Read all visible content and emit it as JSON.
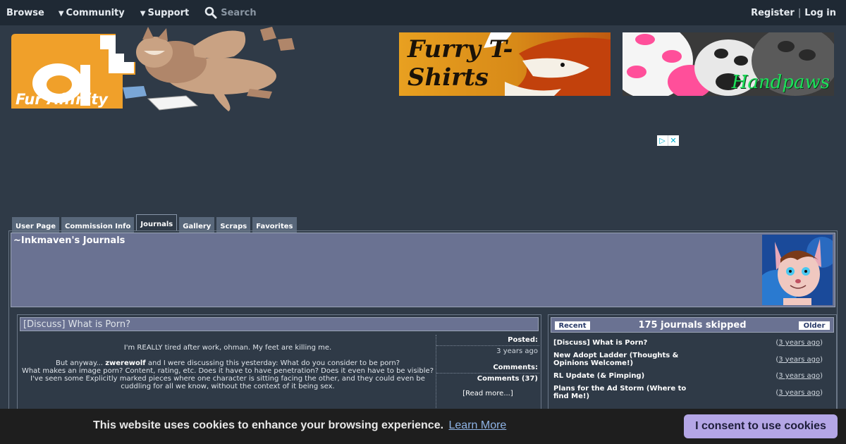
{
  "nav": {
    "browse": "Browse",
    "community": "Community",
    "support": "Support",
    "search_placeholder": "Search",
    "register": "Register",
    "sep": "|",
    "login": "Log in"
  },
  "logo": {
    "text": "Fur Affinity"
  },
  "banners": {
    "shirts": "Furry T-Shirts",
    "paws": "Handpaws"
  },
  "tabs": [
    {
      "label": "User Page"
    },
    {
      "label": "Commission Info"
    },
    {
      "label": "Journals",
      "active": true
    },
    {
      "label": "Gallery"
    },
    {
      "label": "Scraps"
    },
    {
      "label": "Favorites"
    }
  ],
  "header": {
    "title": "~Inkmaven's Journals"
  },
  "post": {
    "title": "[Discuss] What is Porn?",
    "line1": "I'm REALLY tired after work, ohman. My feet are killing me.",
    "line2_pre": "But anyway... ",
    "line2_user": "zwerewolf",
    "line2_post": " and I were discussing this yesterday: What do you consider to be porn?",
    "line3": "What makes an image porn? Content, rating, etc. Does it have to have penetration? Does it even have to be visible? I've seen some Explicitly marked pieces where one character is sitting facing the other, and they could even be cuddling for all we know, without the context of it being sex.",
    "posted_label": "Posted:",
    "posted_value": "3 years ago",
    "comments_label": "Comments:",
    "comments_value": "Comments (37)",
    "read_more": "[Read more...]"
  },
  "side": {
    "recent": "Recent",
    "skipped": "175 journals skipped",
    "older": "Older",
    "items": [
      {
        "title": "[Discuss] What is Porn?",
        "age": "3 years ago"
      },
      {
        "title": "New Adopt Ladder (Thoughts & Opinions Welcome!)",
        "age": "3 years ago"
      },
      {
        "title": "RL Update (& Pimping)",
        "age": "3 years ago"
      },
      {
        "title": "Plans for the Ad Storm (Where to find Me!)",
        "age": "3 years ago"
      }
    ]
  },
  "cookie": {
    "text": "This website uses cookies to enhance your browsing experience.",
    "learn_more": "Learn More",
    "consent": "I consent to use cookies"
  },
  "colors": {
    "page_bg": "#2f3a47",
    "nav_bg": "#1f2934",
    "panel": "#6a7292",
    "logo_orange": "#f0a02a",
    "cookie_button": "#b4a6e6"
  }
}
